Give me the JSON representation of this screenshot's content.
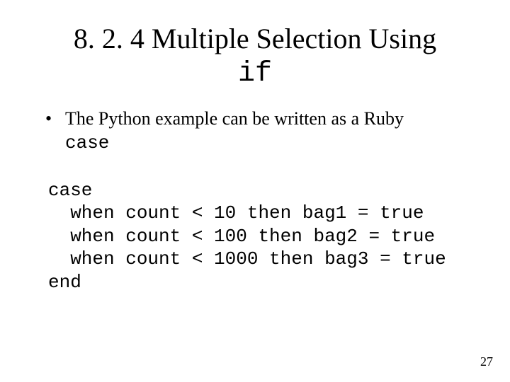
{
  "title": {
    "line1": "8. 2. 4 Multiple Selection Using",
    "code": "if"
  },
  "bullet": {
    "text_prefix": "The Python example can be written as a Ruby ",
    "text_code": "case"
  },
  "code": {
    "l1": "case",
    "l2": "  when count < 10 then bag1 = true",
    "l3": "  when count < 100 then bag2 = true",
    "l4": "  when count < 1000 then bag3 = true",
    "l5": "end"
  },
  "page_number": "27"
}
